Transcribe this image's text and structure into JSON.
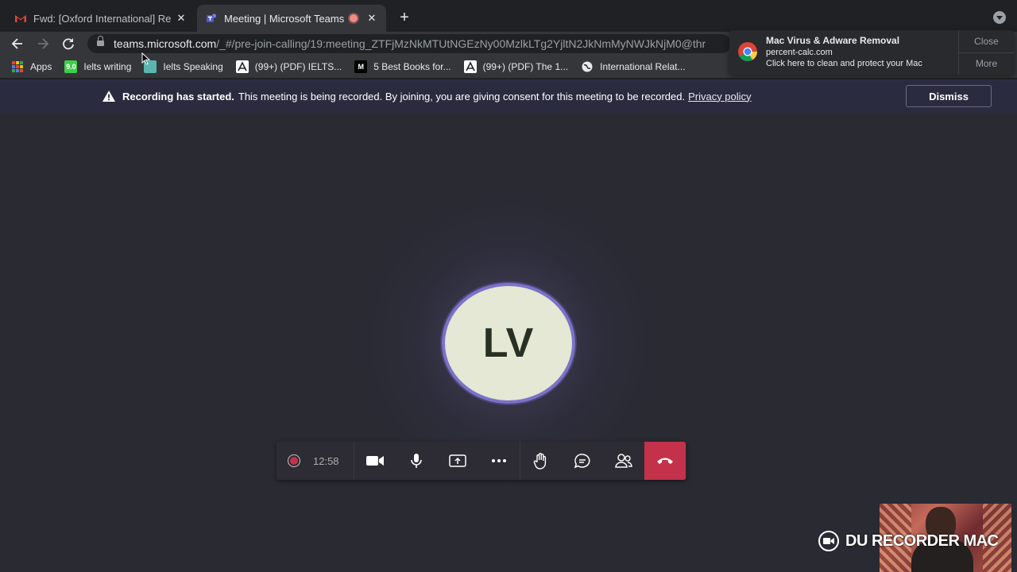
{
  "tabs": [
    {
      "title": "Fwd: [Oxford International] Re",
      "close": "✕",
      "icon": "gmail-icon",
      "active": false
    },
    {
      "title": "Meeting | Microsoft Teams",
      "close": "✕",
      "icon": "teams-icon",
      "active": true
    }
  ],
  "new_tab": "+",
  "toolbar": {
    "url_domain": "teams.microsoft.com",
    "url_path": "/_#/pre-join-calling/19:meeting_ZTFjMzNkMTUtNGEzNy00MzlkLTg2YjltN2JkNmMyNWJkNjM0@thr"
  },
  "bookmarks": [
    {
      "label": "Apps",
      "icon": "apps-grid-icon"
    },
    {
      "label": "Ielts writing",
      "icon": "9.0-badge-icon",
      "badge": "9.0"
    },
    {
      "label": "Ielts Speaking",
      "icon": "bookmark-image-icon"
    },
    {
      "label": "(99+) (PDF) IELTS...",
      "icon": "academia-icon"
    },
    {
      "label": "5 Best Books for...",
      "icon": "medium-icon",
      "badge": "M"
    },
    {
      "label": "(99+) (PDF) The 1...",
      "icon": "academia-icon"
    },
    {
      "label": "International Relat...",
      "icon": "globe-icon"
    }
  ],
  "notification": {
    "title": "Mac Virus & Adware Removal",
    "site": "percent-calc.com",
    "message": "Click here to clean and protect your Mac",
    "close_label": "Close",
    "more_label": "More"
  },
  "banner": {
    "bold_text": "Recording has started.",
    "text": "This meeting is being recorded. By joining, you are giving consent for this meeting to be recorded.",
    "link": "Privacy policy",
    "dismiss_label": "Dismiss"
  },
  "participant": {
    "initials": "LV"
  },
  "callbar": {
    "timer": "12:58"
  },
  "watermark": {
    "text": "DU RECORDER MAC"
  },
  "colors": {
    "hangup": "#c4314b",
    "avatar_ring": "#7b72c9",
    "banner_bg": "#2b2b40",
    "stage_bg": "#2a2a33"
  }
}
